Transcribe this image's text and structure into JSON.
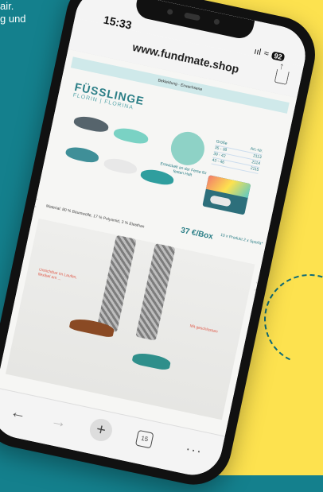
{
  "promo": {
    "line1": "air.",
    "line2": "g und"
  },
  "status": {
    "time": "15:33",
    "signal": "ııl",
    "wifi": "≈",
    "battery": "92"
  },
  "browser": {
    "url": "www.fundmate.shop"
  },
  "page": {
    "category": "Bekleidung · Erwachsene",
    "title": "FÜSSLINGE",
    "subtitle": "FLORIN | FLORINA",
    "yarn_caption": "Entwickelt an der Ferse für festen Halt",
    "sizes": {
      "header": [
        "Größe",
        "Art.-Nr."
      ],
      "rows": [
        [
          "35 - 38",
          "2113"
        ],
        [
          "39 - 42",
          "2114"
        ],
        [
          "43 - 46",
          "2115"
        ]
      ]
    },
    "price": "37 €/Box",
    "price_note": "10 x Produkt 2 x Sparfa*",
    "material": "Material: 80 % Baumwolle, 17 % Polyamid, 3 % Elasthan",
    "pointer_left": "Unsichtbar im Laufen, flexibel am ...",
    "pointer_right": "Mit geschlossen"
  },
  "toolbar": {
    "back": "←",
    "forward": "→",
    "new_tab": "+",
    "tabs_count": "15",
    "more": "···"
  },
  "colors": {
    "teal_bg": "#14808d",
    "yellow_bg": "#fde24f",
    "brand_teal": "#2a7e86"
  }
}
